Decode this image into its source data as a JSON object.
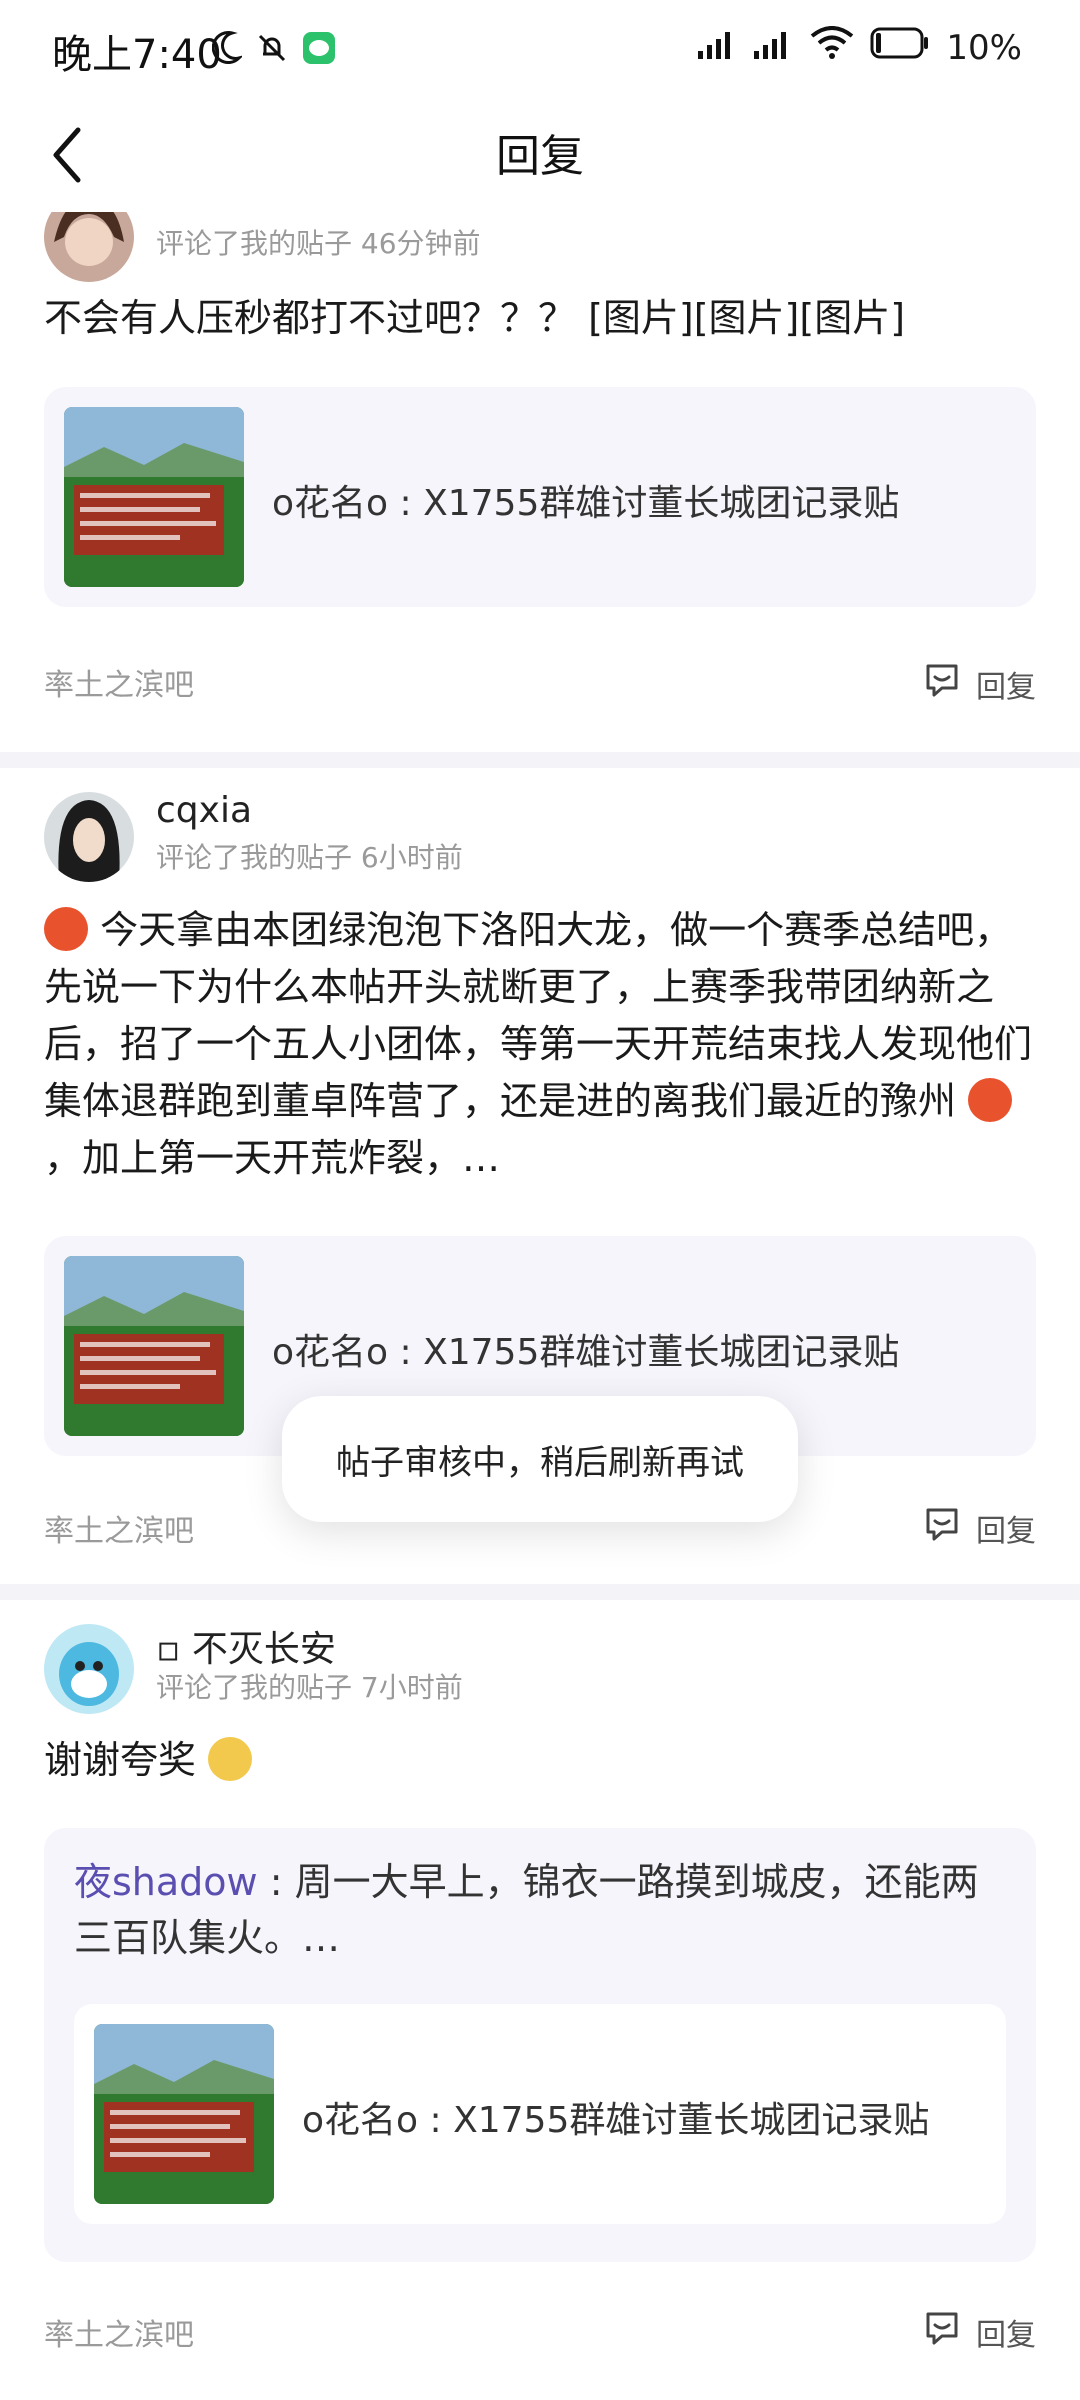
{
  "status_bar": {
    "time": "晚上7:40",
    "battery": "10%"
  },
  "app_bar": {
    "title": "回复"
  },
  "posts": [
    {
      "username": "",
      "meta": "评论了我的贴子  46分钟前",
      "text": "不会有人压秒都打不过吧？？？ [图片][图片][图片]",
      "quote_title": "o花名o : X1755群雄讨董长城团记录贴",
      "forum": "率土之滨吧",
      "reply_label": "回复"
    },
    {
      "username": "cqxia",
      "meta": "评论了我的贴子  6小时前",
      "text_1": "今天拿由本团绿泡泡下洛阳大龙，做一个赛季总结吧，先说一下为什么本帖开头就断更了，上赛季我带团纳新之后，招了一个五人小团体，等第一天开荒结束找人发现他们集体退群跑到董卓阵营了，还是进的离我们最近的豫州",
      "text_2": "，加上第一天开荒炸裂，…",
      "quote_title": "o花名o : X1755群雄讨董长城团记录贴",
      "forum": "率土之滨吧",
      "reply_label": "回复"
    },
    {
      "username": "▫ 不灭长安",
      "meta": "评论了我的贴子  7小时前",
      "text": "谢谢夸奖",
      "quote_mention": "夜shadow",
      "quote_text": " : 周一大早上，锦衣一路摸到城皮，还能两三百队集火。…",
      "quote_title": "o花名o : X1755群雄讨董长城团记录贴",
      "forum": "率土之滨吧",
      "reply_label": "回复"
    }
  ],
  "toast": {
    "text": "帖子审核中，稍后刷新再试"
  },
  "colors": {
    "accent": "#5a4fb0",
    "meta_gray": "#9a9a9a",
    "quote_bg": "#f5f5fb"
  },
  "icons": [
    "moon-icon",
    "mute-icon",
    "wechat-icon",
    "signal-icon",
    "wifi-icon",
    "battery-icon",
    "back-icon",
    "comment-icon"
  ]
}
